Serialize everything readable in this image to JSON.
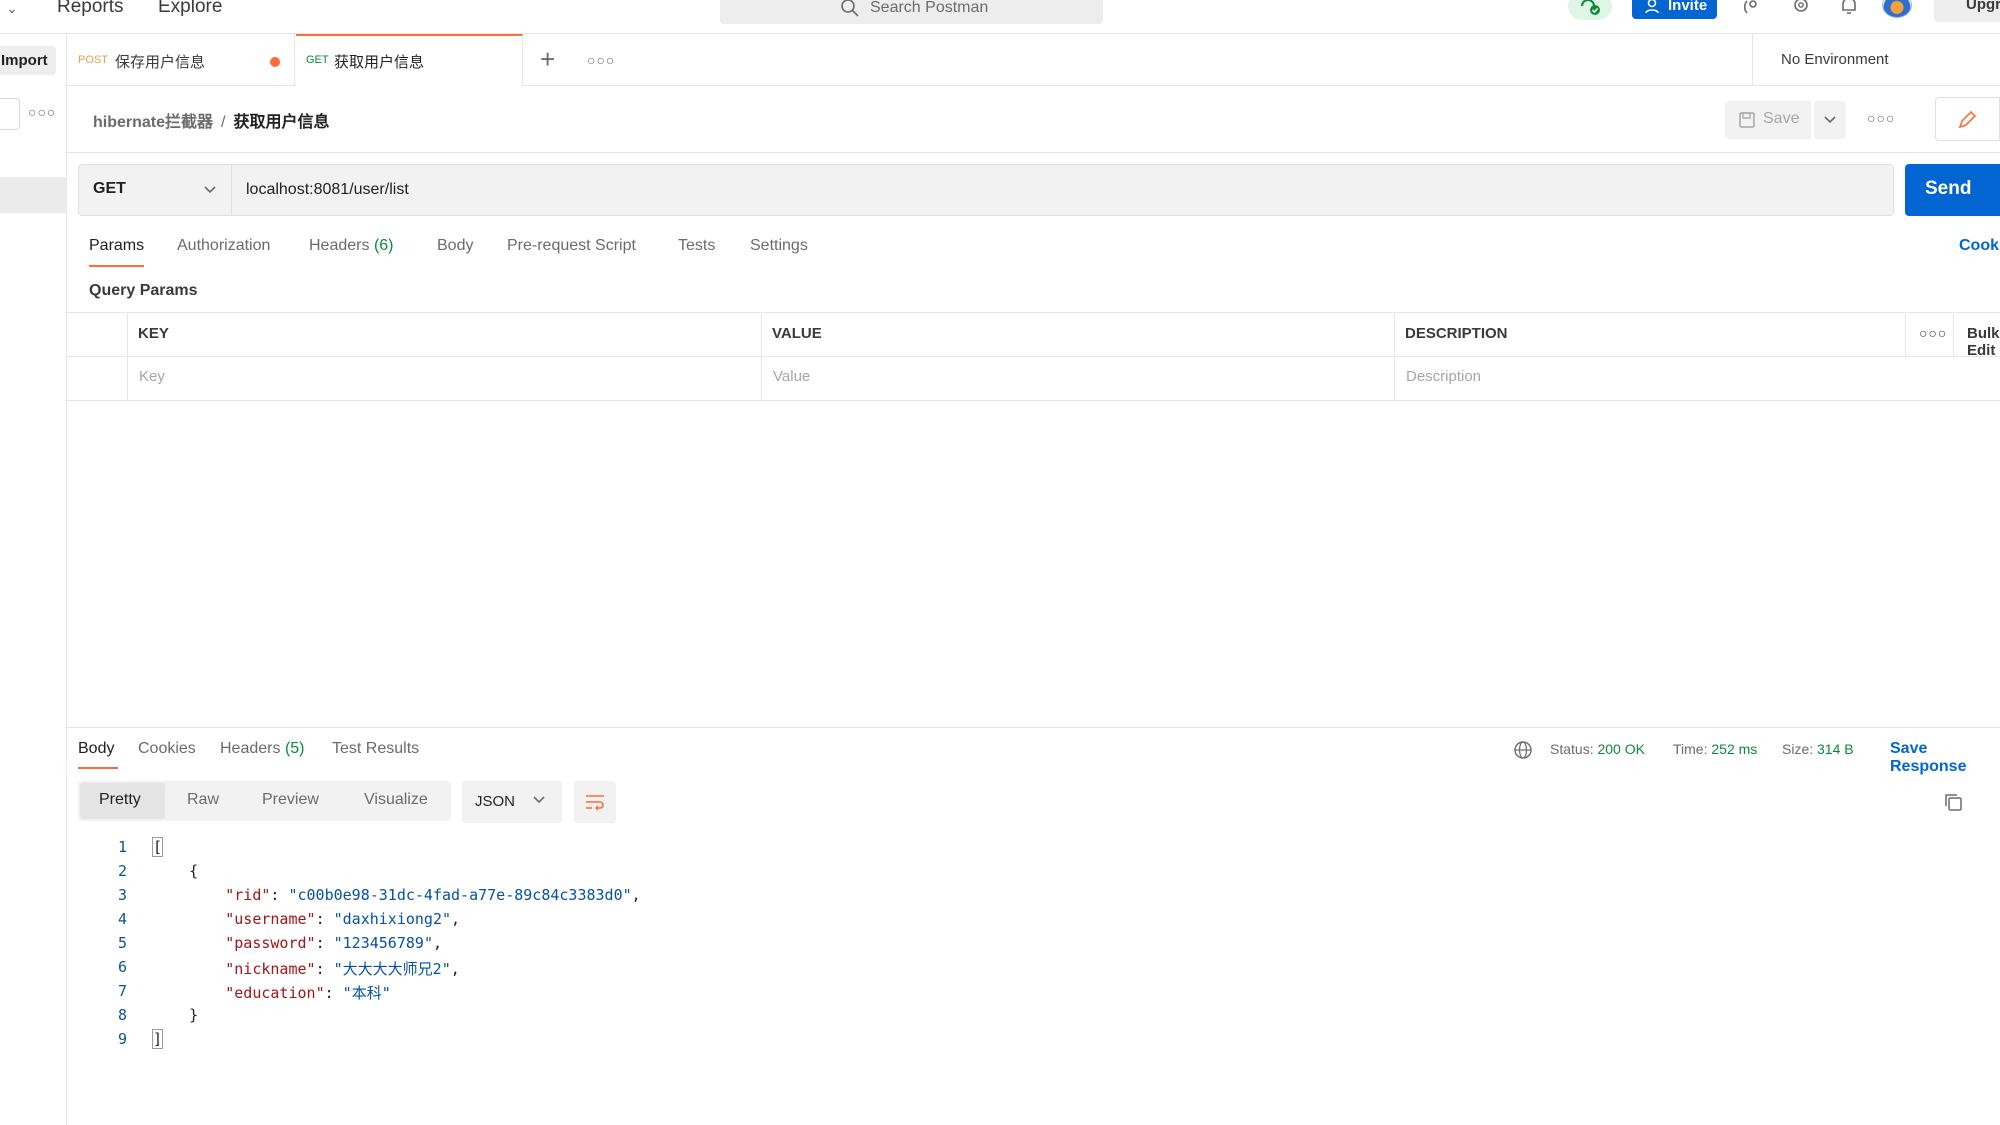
{
  "header": {
    "nav": [
      "Reports",
      "Explore"
    ],
    "search_placeholder": "Search Postman",
    "invite_label": "Invite",
    "upgrade_label": "Upgrade"
  },
  "sidebar": {
    "import_label": "Import"
  },
  "tabs": [
    {
      "method": "POST",
      "label": "保存用户信息",
      "unsaved": true
    },
    {
      "method": "GET",
      "label": "获取用户信息",
      "active": true
    }
  ],
  "environment": "No Environment",
  "breadcrumb": {
    "collection": "hibernate拦截器",
    "request": "获取用户信息"
  },
  "request": {
    "save_label": "Save",
    "method": "GET",
    "url": "localhost:8081/user/list",
    "send_label": "Send",
    "tabs": [
      {
        "label": "Params",
        "active": true
      },
      {
        "label": "Authorization"
      },
      {
        "label": "Headers",
        "count": "(6)"
      },
      {
        "label": "Body"
      },
      {
        "label": "Pre-request Script"
      },
      {
        "label": "Tests"
      },
      {
        "label": "Settings"
      }
    ],
    "cookies_label": "Cookies",
    "query_params_title": "Query Params",
    "columns": [
      "KEY",
      "VALUE",
      "DESCRIPTION"
    ],
    "bulk_label": "Bulk Edit",
    "placeholders": {
      "key": "Key",
      "value": "Value",
      "description": "Description"
    }
  },
  "response": {
    "tabs": [
      {
        "label": "Body",
        "active": true
      },
      {
        "label": "Cookies"
      },
      {
        "label": "Headers",
        "count": "(5)"
      },
      {
        "label": "Test Results"
      }
    ],
    "status_label": "Status:",
    "status_value": "200 OK",
    "time_label": "Time:",
    "time_value": "252 ms",
    "size_label": "Size:",
    "size_value": "314 B",
    "save_response_label": "Save Response",
    "views": [
      "Pretty",
      "Raw",
      "Preview",
      "Visualize"
    ],
    "format": "JSON",
    "lines": [
      {
        "n": "1",
        "text": "["
      },
      {
        "n": "2",
        "text": "    {"
      },
      {
        "n": "3",
        "key": "rid",
        "value": "c00b0e98-31dc-4fad-a77e-89c84c3383d0",
        "comma": ","
      },
      {
        "n": "4",
        "key": "username",
        "value": "daxhixiong2",
        "comma": ","
      },
      {
        "n": "5",
        "key": "password",
        "value": "123456789",
        "comma": ","
      },
      {
        "n": "6",
        "key": "nickname",
        "value": "大大大大师兄2",
        "comma": ","
      },
      {
        "n": "7",
        "key": "education",
        "value": "本科",
        "comma": ""
      },
      {
        "n": "8",
        "text": "    }"
      },
      {
        "n": "9",
        "text": "]"
      }
    ]
  },
  "colors": {
    "accent": "#ff6c37",
    "primary": "#0265d2",
    "success": "#0a8a3b"
  }
}
